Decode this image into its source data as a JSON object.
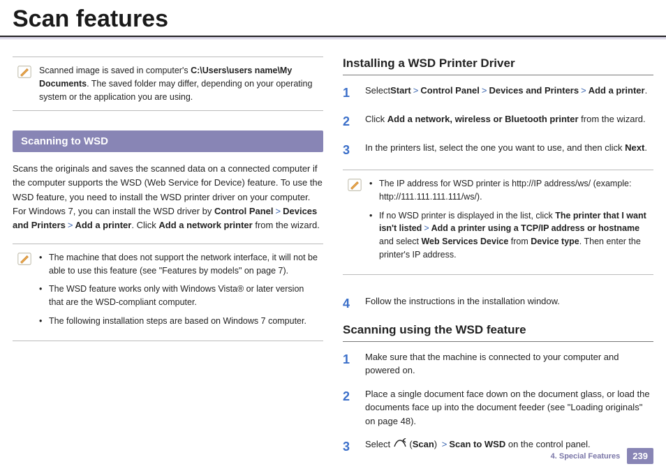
{
  "title": "Scan features",
  "left": {
    "note1": {
      "text_a": "Scanned image is saved in computer's ",
      "path_b": "C:\\Users\\users name\\My Documents",
      "text_c": ". The saved folder may differ, depending on your operating system or the application you are using."
    },
    "band": "Scanning to WSD",
    "intro": {
      "a": "Scans the originals and saves the scanned data on a connected computer if the computer supports the WSD (Web Service for Device) feature. To use the WSD feature, you need to install the WSD printer driver on your computer. For Windows 7, you can install the WSD driver by ",
      "b": "Control Panel",
      "c": "Devices and Printers",
      "d": "Add a printer",
      "e": ". Click ",
      "f": "Add a network printer",
      "g": " from the wizard."
    },
    "note2": {
      "li1": "The machine that does not support the network interface, it will not be able to use this feature (see \"Features by models\" on page 7).",
      "li2": "The WSD feature works only with Windows Vista® or later version that are the WSD-compliant computer.",
      "li3": "The following installation steps are based on Windows 7 computer."
    }
  },
  "right": {
    "h1": "Installing a WSD Printer Driver",
    "s1": {
      "a": "Select",
      "b": "Start",
      "c": "Control Panel",
      "d": "Devices and Printers",
      "e": "Add a printer",
      "f": "."
    },
    "s2": {
      "a": "Click ",
      "b": "Add a network, wireless or Bluetooth printer",
      "c": " from the wizard."
    },
    "s3": {
      "a": "In the printers list, select the one you want to use, and then click ",
      "b": "Next",
      "c": "."
    },
    "note": {
      "li1a": "The IP address for WSD printer is http://IP address/ws/ (example: ",
      "li1b": "http://111.111.111.111/ws/",
      "li1c": ").",
      "li2a": "If no WSD printer is displayed in the list, click ",
      "li2b": "The printer that I want isn't listed",
      "li2c": "Add a printer using a TCP/IP address or hostname",
      "li2d": " and select ",
      "li2e": "Web Services Device",
      "li2f": " from ",
      "li2g": "Device type",
      "li2h": ". Then enter the printer's IP address."
    },
    "s4": "Follow the instructions in the installation window.",
    "h2": "Scanning using the WSD feature",
    "u1": "Make sure that the machine is connected to your computer and powered on.",
    "u2": "Place a single document face down on the document glass, or load the documents face up into the document feeder (see \"Loading originals\" on page 48).",
    "u3": {
      "a": "Select ",
      "b": "Scan",
      "c": "Scan to WSD",
      "d": " on the control panel."
    }
  },
  "footer": {
    "chapter": "4.  Special Features",
    "page": "239"
  },
  "nums": {
    "n1": "1",
    "n2": "2",
    "n3": "3",
    "n4": "4"
  },
  "sym": {
    "gt": ">",
    "paren_open": " (",
    "paren_close": ") "
  }
}
